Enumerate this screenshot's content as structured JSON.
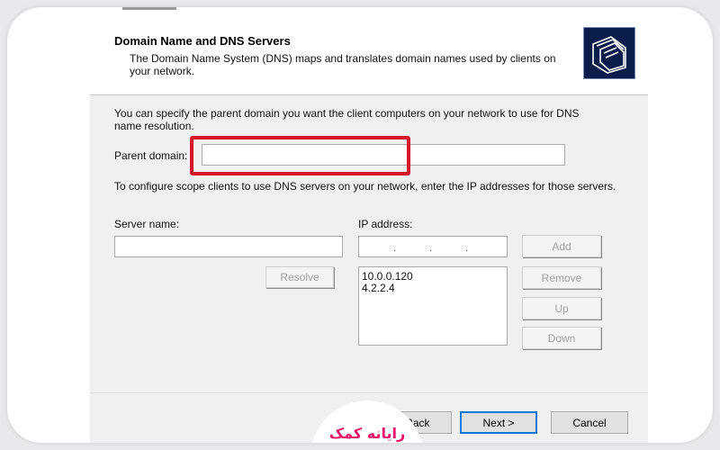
{
  "header": {
    "title": "Domain Name and DNS Servers",
    "description": "The Domain Name System (DNS) maps and translates domain names used by clients on your network.",
    "icon": "wizard-folders-icon"
  },
  "intro_text": "You can specify the parent domain you want the client computers on your network to use for DNS name resolution.",
  "parent_domain": {
    "label": "Parent domain:",
    "value": ""
  },
  "scope_text": "To configure scope clients to use DNS servers on your network, enter the IP addresses for those servers.",
  "server_name": {
    "label": "Server name:",
    "value": ""
  },
  "ip_address": {
    "label": "IP address:",
    "value": ""
  },
  "buttons": {
    "resolve": "Resolve",
    "add": "Add",
    "remove": "Remove",
    "up": "Up",
    "down": "Down",
    "back": "< Back",
    "next": "Next >",
    "cancel": "Cancel"
  },
  "ip_list": [
    "10.0.0.120",
    "4.2.2.4"
  ],
  "watermark": {
    "text": "رایانه کمک",
    "color": "#e8106a"
  },
  "colors": {
    "highlight": "#d6162c",
    "accent": "#0078d7"
  }
}
